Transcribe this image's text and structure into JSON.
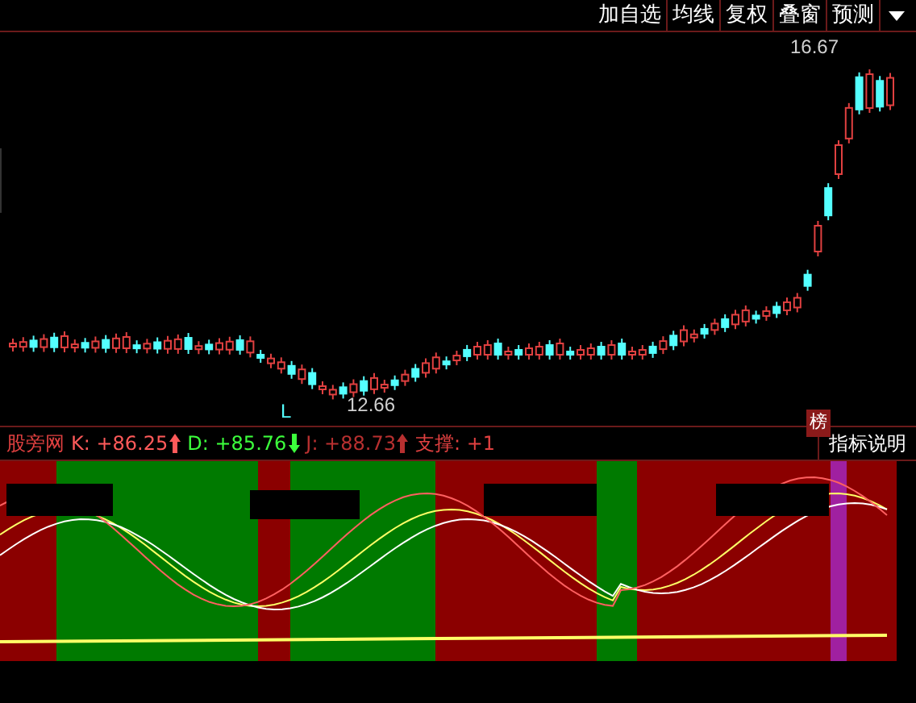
{
  "toolbar": [
    {
      "label": "加自选"
    },
    {
      "label": "均线"
    },
    {
      "label": "复权"
    },
    {
      "label": "叠窗"
    },
    {
      "label": "预测"
    }
  ],
  "price_chart": {
    "high_label": "16.67",
    "low_label": "12.66",
    "low_marker": "L",
    "rank_badge": "榜"
  },
  "indicator_bar": {
    "source": "股旁网",
    "readings": [
      {
        "label": "K: +86.25",
        "color": "#ff5a5a",
        "kind": "up"
      },
      {
        "label": "D: +85.76",
        "color": "#3cff3c",
        "kind": "down"
      },
      {
        "label": "J: +88.73",
        "color": "#b83030",
        "kind": "up"
      },
      {
        "label": "支撑: +1",
        "color": "#e04040",
        "kind": "plain"
      }
    ],
    "help_button": "指标说明"
  }
}
